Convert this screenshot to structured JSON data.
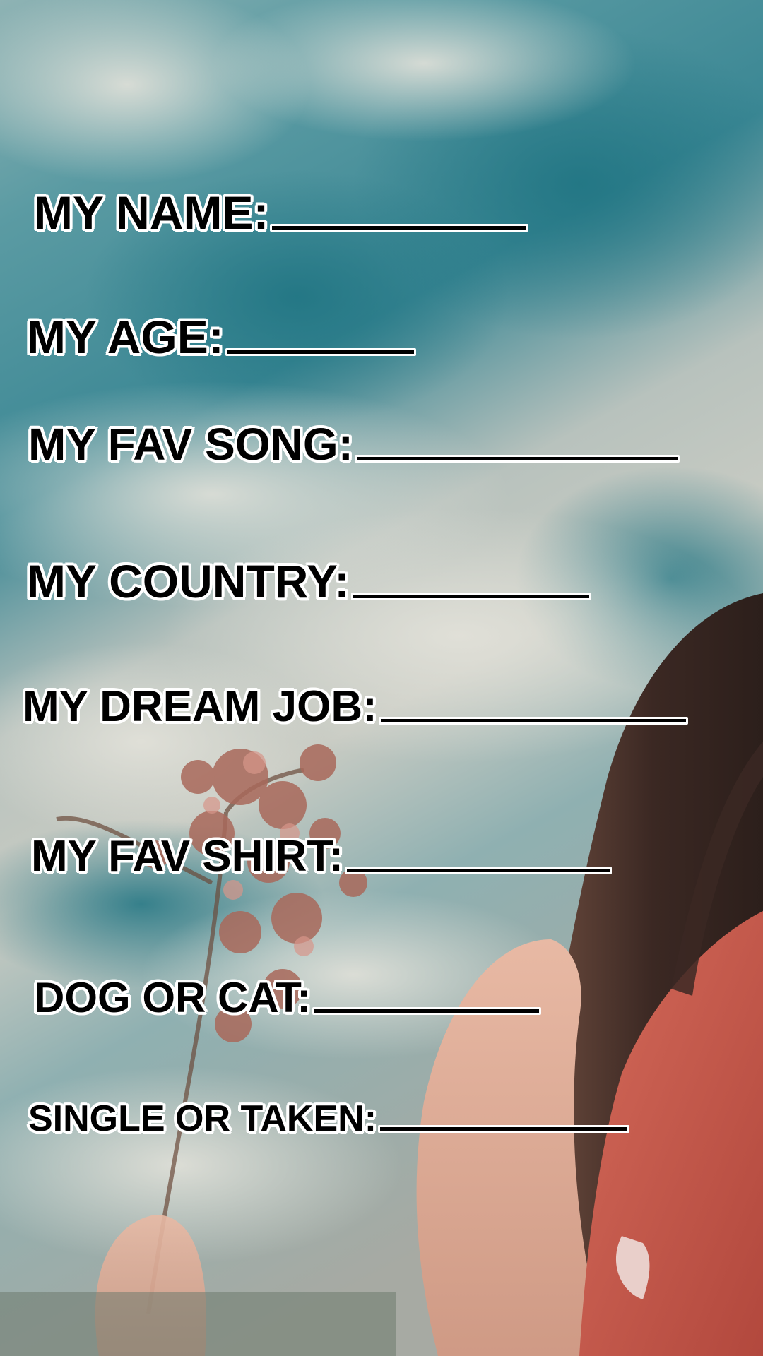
{
  "form": {
    "prompts": [
      {
        "label": "MY NAME:"
      },
      {
        "label": "MY AGE:"
      },
      {
        "label": "MY FAV SONG:"
      },
      {
        "label": "MY COUNTRY:"
      },
      {
        "label": "MY DREAM JOB:"
      },
      {
        "label": "MY FAV SHIRT:"
      },
      {
        "label": "DOG OR CAT:"
      },
      {
        "label": "SINGLE OR TAKEN:"
      }
    ]
  },
  "colors": {
    "sky_top": "#2f7f8a",
    "sky_mid": "#6aa6ad",
    "cloud": "#c9cfc6",
    "shirt": "#c4584a",
    "hair": "#3a2a25",
    "flowers": "#a86a5c",
    "text": "#000000",
    "outline": "#ffffff"
  }
}
